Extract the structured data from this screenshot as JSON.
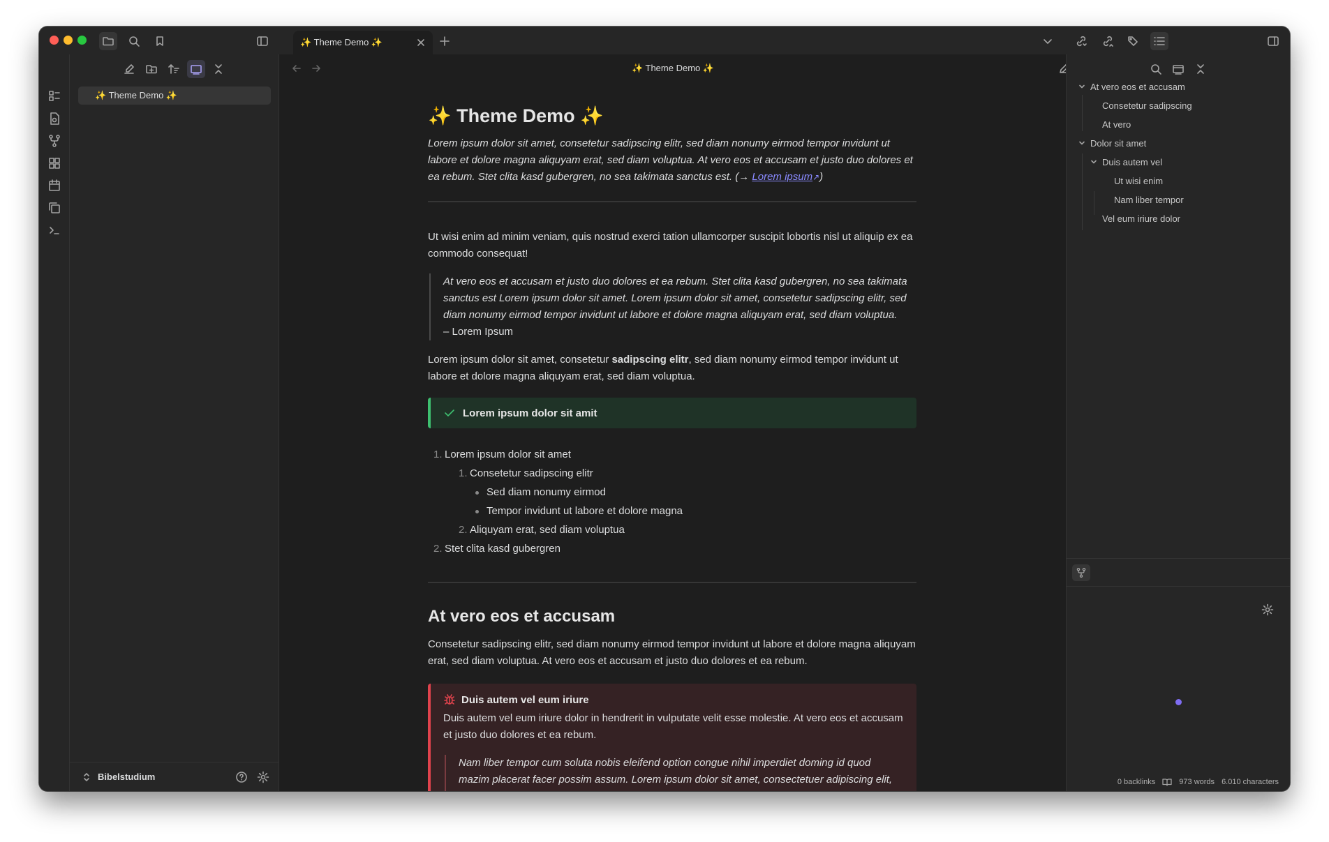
{
  "tab": {
    "title": "✨ Theme Demo ✨"
  },
  "file_explorer": {
    "items": [
      "✨ Theme Demo ✨"
    ],
    "vault_name": "Bibelstudium"
  },
  "editor": {
    "header_title": "✨ Theme Demo ✨",
    "title": "✨ Theme Demo ✨",
    "intro": "Lorem ipsum dolor sit amet, consetetur sadipscing elitr, sed diam nonumy eirmod tempor invidunt ut labore et dolore magna aliquyam erat, sed diam voluptua. At vero eos et accusam et justo duo dolores et ea rebum. Stet clita kasd gubergren, no sea takimata sanctus est. (→ ",
    "intro_link": "Lorem ipsum",
    "intro_end": ")",
    "para1": "Ut wisi enim ad minim veniam, quis nostrud exerci tation ullamcorper suscipit lobortis nisl ut aliquip ex ea commodo consequat!",
    "quote": "At vero eos et accusam et justo duo dolores et ea rebum. Stet clita kasd gubergren, no sea takimata sanctus est Lorem ipsum dolor sit amet. Lorem ipsum dolor sit amet, consetetur sadipscing elitr, sed diam nonumy eirmod tempor invidunt ut labore et dolore magna aliquyam erat, sed diam voluptua.",
    "quote_author": "– Lorem Ipsum",
    "para2_a": "Lorem ipsum dolor sit amet, consetetur ",
    "para2_bold": "sadipscing elitr",
    "para2_b": ", sed diam nonumy eirmod tempor invidunt ut labore et dolore magna aliquyam erat, sed diam voluptua.",
    "success_callout": "Lorem ipsum dolor sit amit",
    "list": {
      "n1": "1.",
      "item1": "Lorem ipsum dolor sit amet",
      "n1_1": "1.",
      "item1_1": "Consetetur sadipscing elitr",
      "bullet1": "Sed diam nonumy eirmod",
      "bullet2": "Tempor invidunt ut labore et dolore magna",
      "n1_2": "2.",
      "item1_2": "Aliquyam erat, sed diam voluptua",
      "n2": "2.",
      "item2": "Stet clita kasd gubergren"
    },
    "heading2": "At vero eos et accusam",
    "para3": "Consetetur sadipscing elitr, sed diam nonumy eirmod tempor invidunt ut labore et dolore magna aliquyam erat, sed diam voluptua. At vero eos et accusam et justo duo dolores et ea rebum.",
    "bug_callout": {
      "title": "Duis autem vel eum iriure",
      "body": "Duis autem vel eum iriure dolor in hendrerit in vulputate velit esse molestie. At vero eos et accusam et justo duo dolores et ea rebum.",
      "quote": "Nam liber tempor cum soluta nobis eleifend option congue nihil imperdiet doming id quod mazim placerat facer possim assum. Lorem ipsum dolor sit amet, consectetuer adipiscing elit, sed diam"
    }
  },
  "outline": {
    "items": [
      "At vero eos et accusam",
      "Consetetur sadipscing",
      "At vero",
      "Dolor sit amet",
      "Duis autem vel",
      "Ut wisi enim",
      "Nam liber tempor",
      "Vel eum iriure dolor"
    ]
  },
  "status_bar": {
    "backlinks": "0 backlinks",
    "words": "973 words",
    "characters": "6.010 characters"
  },
  "colors": {
    "accent": "#7f6df2",
    "success": "#3ec070",
    "bug": "#e0434d",
    "link": "#8a8aff"
  }
}
